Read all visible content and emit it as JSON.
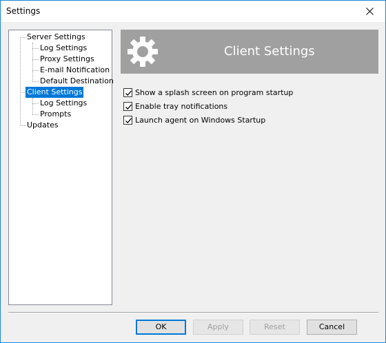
{
  "window": {
    "title": "Settings"
  },
  "tree": {
    "items": [
      {
        "label": "Server Settings"
      },
      {
        "label": "Log Settings"
      },
      {
        "label": "Proxy Settings"
      },
      {
        "label": "E-mail Notification"
      },
      {
        "label": "Default Destination"
      },
      {
        "label": "Client Settings"
      },
      {
        "label": "Log Settings"
      },
      {
        "label": "Prompts"
      },
      {
        "label": "Updates"
      }
    ],
    "selected": "Client Settings"
  },
  "panel": {
    "title": "Client Settings",
    "icon": "gear-icon",
    "options": [
      {
        "label": "Show a splash screen on program startup",
        "checked": true
      },
      {
        "label": "Enable tray notifications",
        "checked": true
      },
      {
        "label": "Launch agent on Windows Startup",
        "checked": true
      }
    ]
  },
  "buttons": {
    "ok": "OK",
    "apply": "Apply",
    "reset": "Reset",
    "cancel": "Cancel"
  },
  "colors": {
    "selection": "#0078d7",
    "banner": "#a0a0a0",
    "window_border": "#1883d7"
  }
}
